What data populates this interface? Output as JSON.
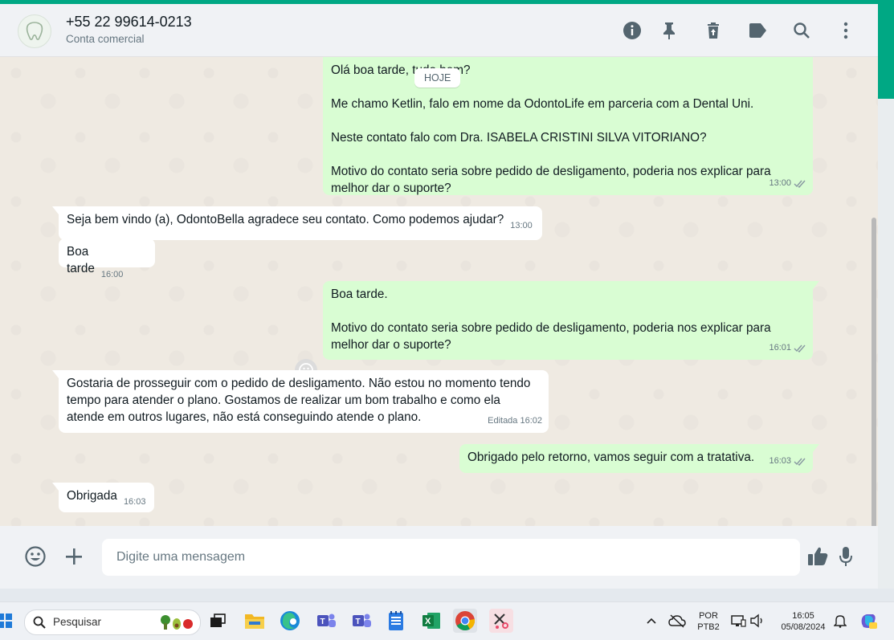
{
  "header": {
    "contact_name": "+55 22 99614-0213",
    "contact_subtitle": "Conta comercial",
    "icons": [
      "info-icon",
      "pin-icon",
      "delete-icon",
      "label-icon",
      "search-icon",
      "menu-icon"
    ]
  },
  "chat": {
    "day_divider": "HOJE",
    "messages": [
      {
        "direction": "out",
        "text": "Olá boa tarde, tudo bem?\n\nMe chamo Ketlin, falo em nome da OdontoLife em parceria com a Dental Uni.\n\nNeste contato falo com Dra. ISABELA CRISTINI SILVA VITORIANO?\n\nMotivo do contato seria sobre pedido de desligamento, poderia nos explicar para melhor dar o suporte?",
        "time": "13:00"
      },
      {
        "direction": "in",
        "text": "Seja bem vindo (a), OdontoBella agradece seu contato. Como podemos ajudar?",
        "time": "13:00"
      },
      {
        "direction": "in",
        "text": "Boa tarde",
        "time": "16:00"
      },
      {
        "direction": "out",
        "text": "Boa tarde.\n\nMotivo do contato seria sobre pedido de desligamento, poderia nos explicar para melhor dar o suporte?",
        "time": "16:01"
      },
      {
        "direction": "in",
        "text": "Gostaria de prosseguir com o pedido de desligamento. Não estou no momento tendo tempo para atender o plano. Gostamos de realizar um bom trabalho e como ela atende em outros lugares, não está conseguindo atende o plano.",
        "time": "Editada 16:02"
      },
      {
        "direction": "out",
        "text": "Obrigado pelo retorno, vamos seguir com a tratativa.",
        "time": "16:03"
      },
      {
        "direction": "in",
        "text": "Obrigada",
        "time": "16:03"
      }
    ]
  },
  "composer": {
    "placeholder": "Digite uma mensagem"
  },
  "taskbar": {
    "search_label": "Pesquisar",
    "lang_top": "POR",
    "lang_bottom": "PTB2",
    "clock_time": "16:05",
    "clock_date": "05/08/2024"
  },
  "colors": {
    "accent": "#00a884",
    "outgoing_bubble": "#d9fdd3",
    "incoming_bubble": "#ffffff",
    "chat_bg": "#efeae2",
    "header_bg": "#f0f2f5"
  }
}
